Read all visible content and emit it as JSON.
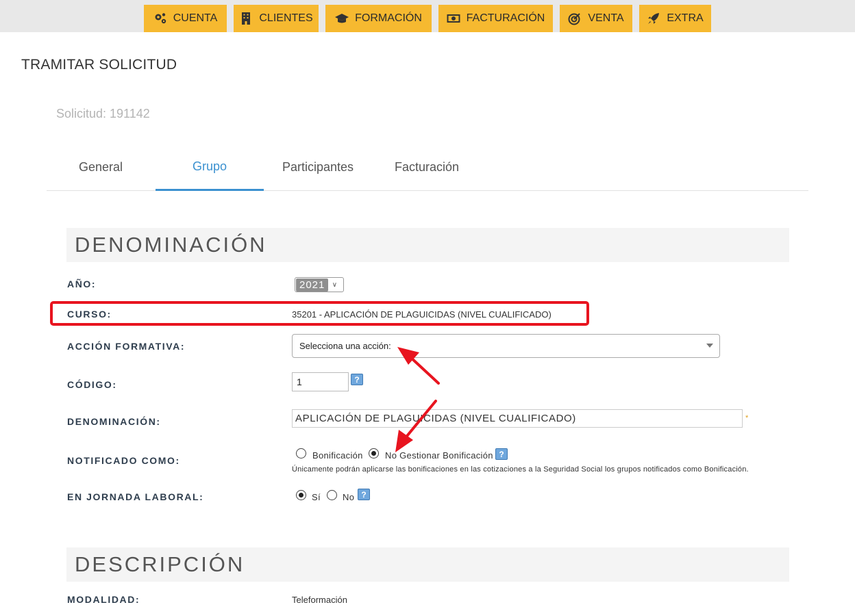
{
  "nav": {
    "items": [
      {
        "label": "CUENTA",
        "icon": "gears-icon"
      },
      {
        "label": "CLIENTES",
        "icon": "building-icon"
      },
      {
        "label": "FORMACIÓN",
        "icon": "graduation-cap-icon"
      },
      {
        "label": "FACTURACIÓN",
        "icon": "banknote-icon"
      },
      {
        "label": "VENTA",
        "icon": "target-icon"
      },
      {
        "label": "EXTRA",
        "icon": "rocket-icon"
      }
    ],
    "color": "#f6b930"
  },
  "page": {
    "title": "TRAMITAR SOLICITUD",
    "solicitud": "Solicitud: 191142"
  },
  "tabs": {
    "items": [
      "General",
      "Grupo",
      "Participantes",
      "Facturación"
    ],
    "active": "Grupo",
    "active_color": "#3b91d0"
  },
  "denominacion": {
    "heading": "DENOMINACIÓN",
    "anio_label": "AÑO:",
    "anio_value": "2021",
    "curso_label": "CURSO:",
    "curso_value": "35201 - APLICACIÓN DE PLAGUICIDAS (NIVEL CUALIFICADO)",
    "accion_label": "ACCIÓN FORMATIVA:",
    "accion_value": "Selecciona una acción:",
    "codigo_label": "CÓDIGO:",
    "codigo_value": "1",
    "den_label": "DENOMINACIÓN:",
    "den_value": "APLICACIÓN DE PLAGUICIDAS (NIVEL CUALIFICADO)",
    "required_mark": "*",
    "notificado_label": "NOTIFICADO COMO:",
    "notificado_options": [
      "Bonificación",
      "No Gestionar Bonificación"
    ],
    "notificado_selected": "No Gestionar Bonificación",
    "notificado_note": "Únicamente podrán aplicarse las bonificaciones en las cotizaciones a la Seguridad Social los grupos notificados como Bonificación.",
    "jornada_label": "EN JORNADA LABORAL:",
    "jornada_options": [
      "Sí",
      "No"
    ],
    "jornada_selected": "Sí",
    "help_glyph": "?"
  },
  "descripcion": {
    "heading": "DESCRIPCIÓN",
    "modalidad_label": "MODALIDAD:",
    "modalidad_value": "Teleformación"
  },
  "annotation_color": "#e8141f"
}
